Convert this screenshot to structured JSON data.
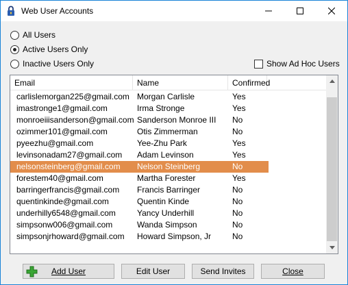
{
  "window": {
    "title": "Web User Accounts"
  },
  "filters": [
    {
      "label": "All Users",
      "checked": false
    },
    {
      "label": "Active Users Only",
      "checked": true
    },
    {
      "label": "Inactive Users Only",
      "checked": false
    }
  ],
  "adhoc": {
    "label": "Show Ad Hoc Users",
    "checked": false
  },
  "columns": {
    "email": "Email",
    "name": "Name",
    "confirmed": "Confirmed"
  },
  "rows": [
    {
      "email": "carlislemorgan225@gmail.com",
      "name": "Morgan Carlisle",
      "confirmed": "Yes"
    },
    {
      "email": "imastronge1@gmail.com",
      "name": "Irma Stronge",
      "confirmed": "Yes"
    },
    {
      "email": "monroeiiisanderson@gmail.com",
      "name": "Sanderson Monroe III",
      "confirmed": "No"
    },
    {
      "email": "ozimmer101@gmail.com",
      "name": "Otis Zimmerman",
      "confirmed": "No"
    },
    {
      "email": "pyeezhu@gmail.com",
      "name": "Yee-Zhu Park",
      "confirmed": "Yes"
    },
    {
      "email": "levinsonadam27@gmail.com",
      "name": "Adam Levinson",
      "confirmed": "Yes"
    },
    {
      "email": "nelsonsteinberg@gmail.com",
      "name": "Nelson Steinberg",
      "confirmed": "No"
    },
    {
      "email": "forestem40@gmail.com",
      "name": "Martha Forester",
      "confirmed": "Yes"
    },
    {
      "email": "barringerfrancis@gmail.com",
      "name": "Francis Barringer",
      "confirmed": "No"
    },
    {
      "email": "quentinkinde@gmail.com",
      "name": "Quentin Kinde",
      "confirmed": "No"
    },
    {
      "email": "underhilly6548@gmail.com",
      "name": "Yancy Underhill",
      "confirmed": "No"
    },
    {
      "email": "simpsonw006@gmail.com",
      "name": "Wanda Simpson",
      "confirmed": "No"
    },
    {
      "email": "simpsonjrhoward@gmail.com",
      "name": "Howard Simpson, Jr",
      "confirmed": "No"
    }
  ],
  "selected_row": 6,
  "buttons": {
    "add": "Add User",
    "edit": "Edit User",
    "send": "Send Invites",
    "close": "Close"
  },
  "colors": {
    "selection": "#e28d4b",
    "border_accent": "#1883d7",
    "add_icon": "#3aa635"
  },
  "icons": {
    "app": "padlock-icon",
    "add": "plus-icon"
  }
}
